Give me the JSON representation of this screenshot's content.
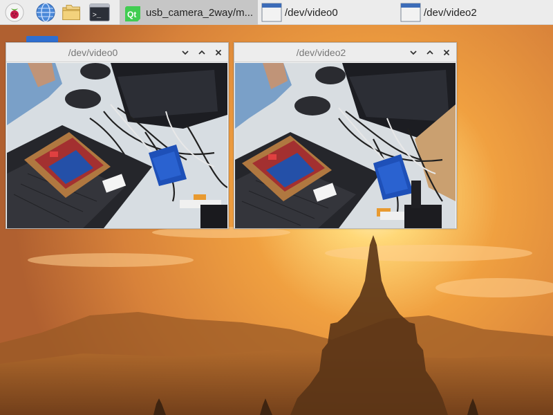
{
  "taskbar": {
    "launchers": [
      {
        "icon": "raspberry-pi-menu-icon"
      },
      {
        "icon": "web-browser-icon"
      },
      {
        "icon": "file-manager-icon"
      },
      {
        "icon": "terminal-icon"
      }
    ],
    "tasks": [
      {
        "label": "usb_camera_2way/m...",
        "icon": "qt-app-icon",
        "active": true
      },
      {
        "label": "/dev/video0",
        "icon": "window-icon",
        "active": false
      },
      {
        "label": "/dev/video2",
        "icon": "window-icon",
        "active": false
      }
    ]
  },
  "windows": [
    {
      "title": "/dev/video0",
      "content": "usb-camera-feed"
    },
    {
      "title": "/dev/video2",
      "content": "usb-camera-feed"
    }
  ],
  "desktop": {
    "wallpaper": "sunset-pagoda",
    "colors": {
      "sky_top": "#f0b050",
      "sun": "#fff6c8",
      "silhouette": "#3e2410"
    }
  },
  "colors": {
    "taskbar_bg": "#ececec",
    "active_task_bg": "#c6c6c6",
    "window_title_text": "#777777"
  }
}
